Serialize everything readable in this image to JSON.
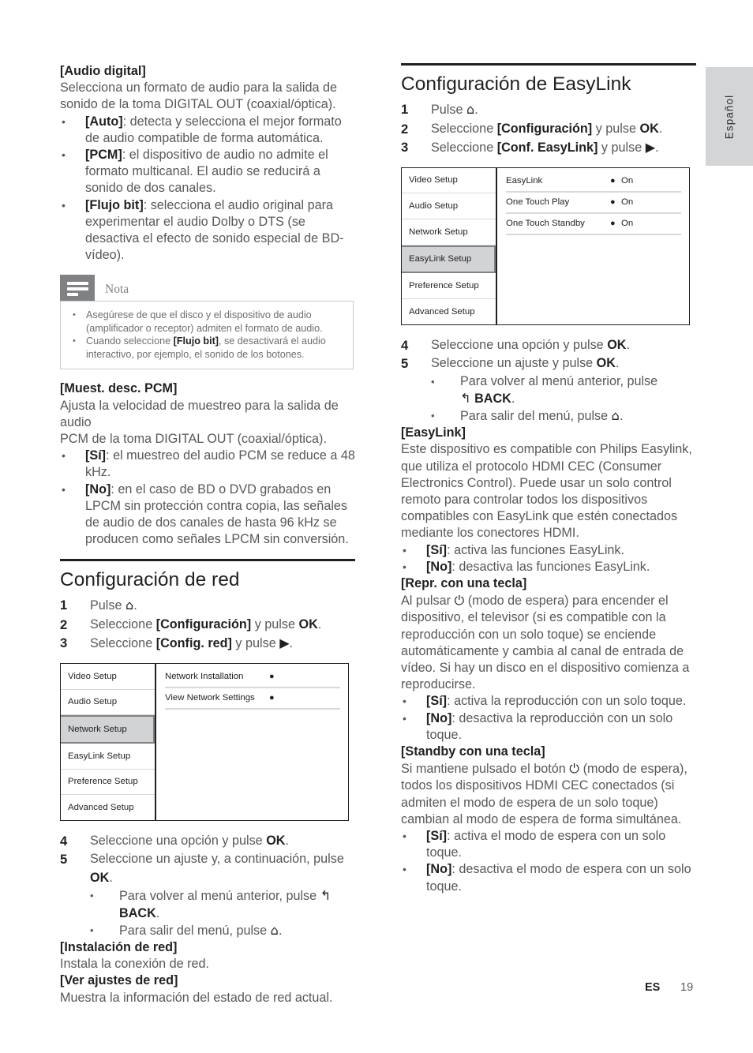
{
  "language_tab": {
    "label": "Español"
  },
  "footer": {
    "locale": "ES",
    "page_number": "19"
  },
  "left_column": {
    "audio_digital": {
      "heading": "[Audio digital]",
      "intro_line1": "Selecciona un formato de audio para la salida de",
      "intro_line2": "sonido de la toma DIGITAL OUT (coaxial/óptica).",
      "bullets": [
        {
          "term": "[Auto]",
          "text": ": detecta y selecciona el mejor formato de audio compatible de forma automática."
        },
        {
          "term": "[PCM]",
          "text": ": el dispositivo de audio no admite el formato multicanal. El audio se reducirá a sonido de dos canales."
        },
        {
          "term": "[Flujo bit]",
          "text": ": selecciona el audio original para experimentar el audio Dolby o DTS (se desactiva el efecto de sonido especial de BD-vídeo)."
        }
      ]
    },
    "nota": {
      "label": "Nota",
      "items": [
        {
          "pre": "Asegúrese de que el disco y el dispositivo de audio (amplificador o receptor) admiten el formato de audio.",
          "bold": "",
          "post": ""
        },
        {
          "pre": "Cuando seleccione ",
          "bold": "[Flujo bit]",
          "post": ", se desactivará el audio interactivo, por ejemplo, el sonido de los botones."
        }
      ]
    },
    "muest_desc_pcm": {
      "heading": "[Muest. desc. PCM]",
      "intro_line1": "Ajusta la velocidad de muestreo para la salida de audio",
      "intro_line2": "PCM de la toma DIGITAL OUT (coaxial/óptica).",
      "bullets": [
        {
          "term": "[Sí]",
          "text": ": el muestreo del audio PCM se reduce a 48 kHz."
        },
        {
          "term": "[No]",
          "text": ": en el caso de BD o DVD grabados en LPCM sin protección contra copia, las señales de audio de dos canales de hasta 96 kHz se producen como señales LPCM sin conversión."
        }
      ]
    },
    "network_section": {
      "title": "Configuración de red",
      "steps": [
        {
          "num": "1",
          "pre": "Pulse ",
          "icon": "home-icon",
          "bold": "",
          "mid": "",
          "post": "."
        },
        {
          "num": "2",
          "pre": "Seleccione ",
          "bold": "[Configuración]",
          "mid": " y pulse ",
          "strong": "OK",
          "post": "."
        },
        {
          "num": "3",
          "pre": "Seleccione ",
          "bold": "[Config. red]",
          "mid": " y pulse ",
          "icon": "play-right-icon",
          "post": "."
        }
      ],
      "osd": {
        "left_items": [
          "Video Setup",
          "Audio Setup",
          "Network Setup",
          "EasyLink Setup",
          "Preference Setup",
          "Advanced Setup"
        ],
        "selected_left": "Network Setup",
        "right_items": [
          {
            "label": "Network Installation",
            "dot": "●",
            "value": ""
          },
          {
            "label": "View Network Settings",
            "dot": "●",
            "value": ""
          }
        ]
      },
      "steps_after": [
        {
          "num": "4",
          "pre": "Seleccione una opción y pulse ",
          "strong": "OK",
          "post": "."
        },
        {
          "num": "5",
          "pre": "Seleccione un ajuste y, a continuación, pulse ",
          "strong": "OK",
          "post": "."
        }
      ],
      "sub_bullets": [
        {
          "pre": "Para volver al menú anterior, pulse ",
          "icon": "back-arrow-icon",
          "strong": "BACK",
          "post": "."
        },
        {
          "pre": "Para salir del menú, pulse ",
          "icon": "home-icon",
          "strong": "",
          "post": "."
        }
      ],
      "definitions": [
        {
          "heading": "[Instalación de red]",
          "body": "Instala la conexión de red."
        },
        {
          "heading": "[Ver ajustes de red]",
          "body": "Muestra la información del estado de red actual."
        }
      ]
    }
  },
  "right_column": {
    "easylink_section": {
      "title": "Configuración de EasyLink",
      "steps": [
        {
          "num": "1",
          "pre": "Pulse ",
          "icon": "home-icon",
          "post": "."
        },
        {
          "num": "2",
          "pre": "Seleccione ",
          "bold": "[Configuración]",
          "mid": " y pulse ",
          "strong": "OK",
          "post": "."
        },
        {
          "num": "3",
          "pre": "Seleccione ",
          "bold": "[Conf. EasyLink]",
          "mid": " y pulse ",
          "icon": "play-right-icon",
          "post": "."
        }
      ],
      "osd": {
        "left_items": [
          "Video Setup",
          "Audio Setup",
          "Network Setup",
          "EasyLink Setup",
          "Preference Setup",
          "Advanced Setup"
        ],
        "selected_left": "EasyLink Setup",
        "right_items": [
          {
            "label": "EasyLink",
            "dot": "●",
            "value": "On"
          },
          {
            "label": "One Touch Play",
            "dot": "●",
            "value": "On"
          },
          {
            "label": "One Touch Standby",
            "dot": "●",
            "value": "On"
          }
        ]
      },
      "steps_after": [
        {
          "num": "4",
          "pre": "Seleccione una opción y pulse ",
          "strong": "OK",
          "post": "."
        },
        {
          "num": "5",
          "pre": "Seleccione un ajuste y pulse ",
          "strong": "OK",
          "post": "."
        }
      ],
      "sub_bullets": [
        {
          "pre": "Para volver al menú anterior, pulse",
          "icon": "back-arrow-icon",
          "strong": "BACK",
          "post": "."
        },
        {
          "pre": "Para salir del menú, pulse ",
          "icon": "home-icon",
          "strong": "",
          "post": "."
        }
      ],
      "easylink_def": {
        "heading": "[EasyLink]",
        "body": "Este dispositivo es compatible con Philips Easylink, que utiliza el protocolo HDMI CEC (Consumer Electronics Control). Puede usar un solo control remoto para controlar todos los dispositivos compatibles con EasyLink que estén conectados mediante los conectores HDMI.",
        "bullets": [
          {
            "term": "[Sí]",
            "text": ": activa las funciones EasyLink."
          },
          {
            "term": "[No]",
            "text": ": desactiva las funciones EasyLink."
          }
        ]
      },
      "one_touch_play": {
        "heading": "[Repr. con una tecla]",
        "body_pre": "Al pulsar ",
        "body_icon": "power-standby-icon",
        "body_post": " (modo de espera) para encender el dispositivo, el televisor (si es compatible con la reproducción con un solo toque) se enciende automáticamente y cambia al canal de entrada de vídeo. Si hay un disco en el dispositivo comienza a reproducirse.",
        "bullets": [
          {
            "term": "[Sí]",
            "text": ": activa la reproducción con un solo toque."
          },
          {
            "term": "[No]",
            "text": ": desactiva la reproducción con un solo toque."
          }
        ]
      },
      "one_touch_standby": {
        "heading": "[Standby con una tecla]",
        "body_pre": "Si mantiene pulsado el botón ",
        "body_icon": "power-standby-icon",
        "body_post": " (modo de espera), todos los dispositivos HDMI CEC conectados (si admiten el modo de espera de un solo toque) cambian al modo de espera de forma simultánea.",
        "bullets": [
          {
            "term": "[Sí]",
            "text": ": activa el modo de espera con un solo toque."
          },
          {
            "term": "[No]",
            "text": ": desactiva el modo de espera con un solo toque."
          }
        ]
      }
    }
  },
  "icons": {
    "home": "⌂",
    "play_right": "▶",
    "back_arrow": "↰",
    "power_standby": "⏻",
    "dot": "●"
  }
}
